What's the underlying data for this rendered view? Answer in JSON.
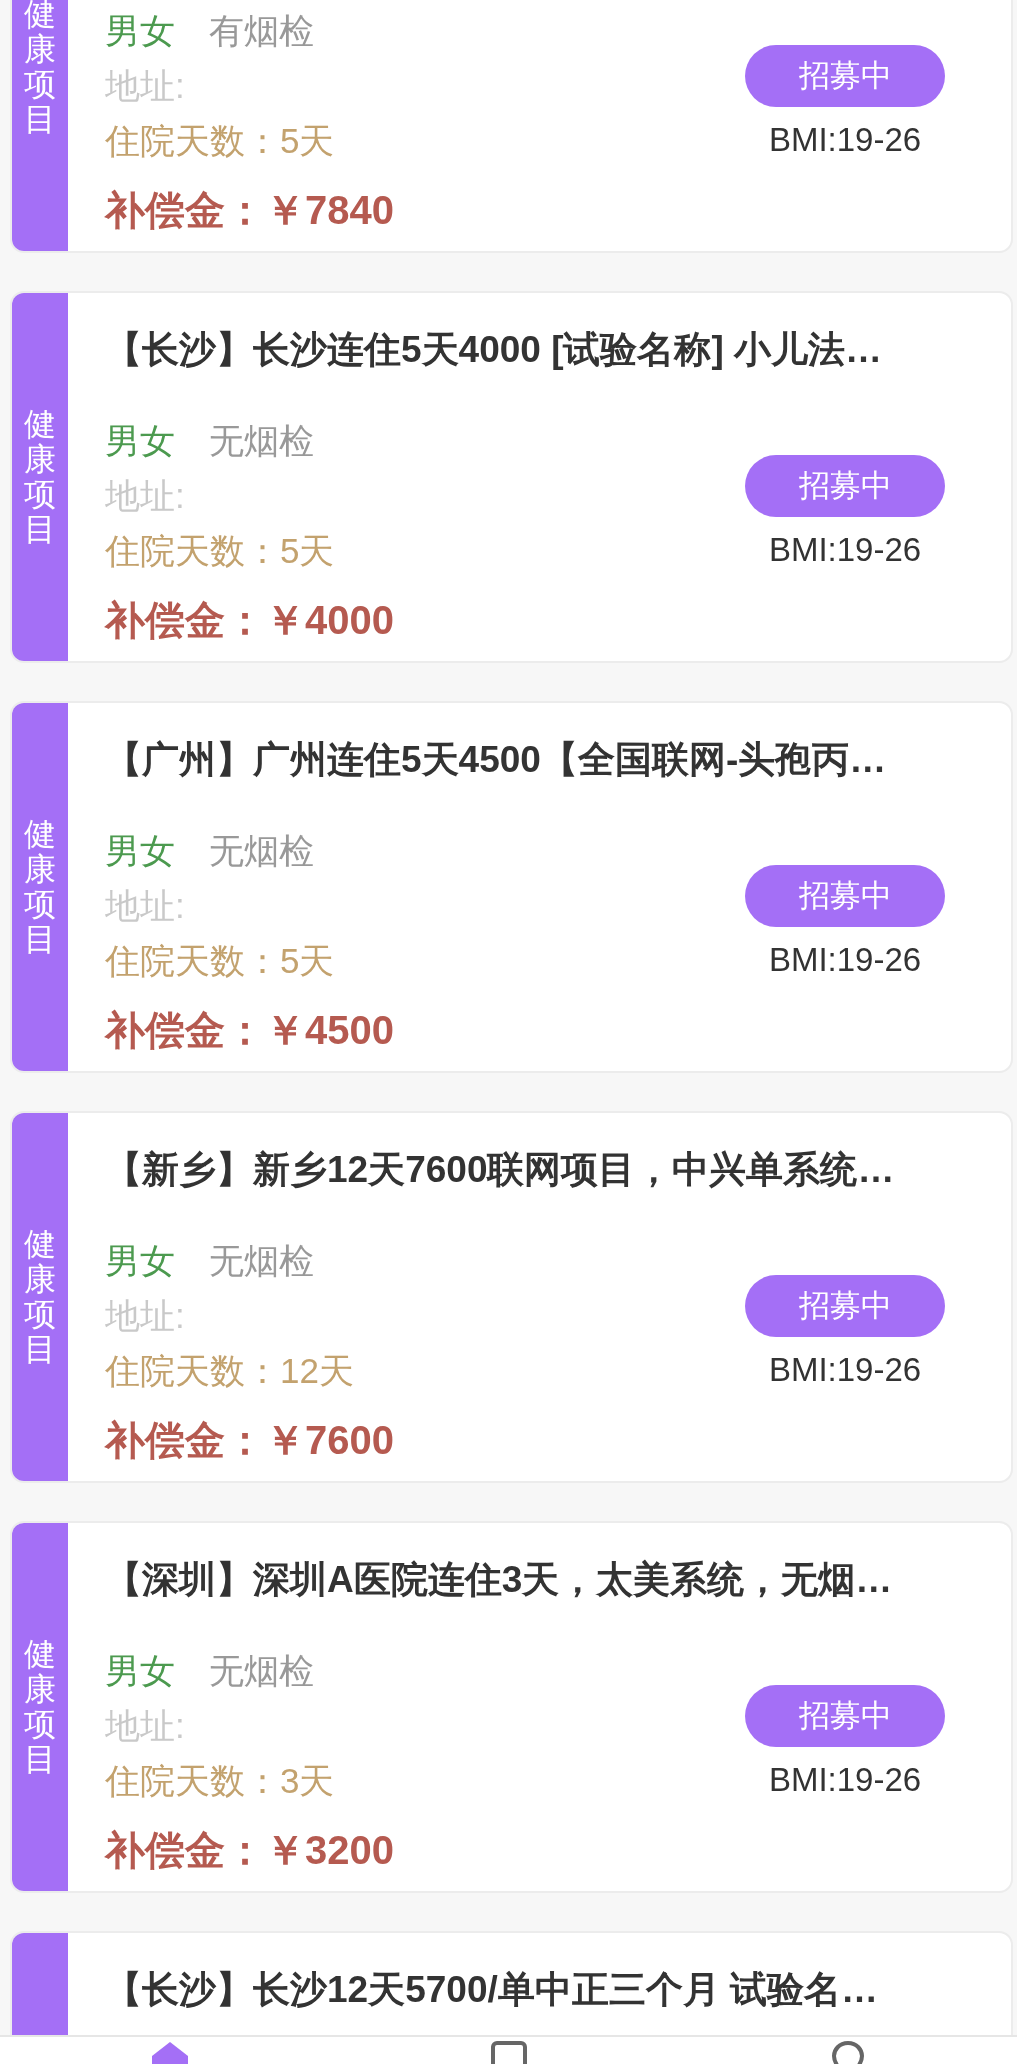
{
  "cards": [
    {
      "tag": "健康项目",
      "gender": "男女",
      "smoke_check": "有烟检",
      "address_label": "地址:",
      "days": "住院天数：5天",
      "compensation": "补偿金：￥7840",
      "status": "招募中",
      "bmi": "BMI:19-26"
    },
    {
      "tag": "健康项目",
      "title": "【长沙】长沙连住5天4000 [试验名称] 小儿法…",
      "gender": "男女",
      "smoke_check": "无烟检",
      "address_label": "地址:",
      "days": "住院天数：5天",
      "compensation": "补偿金：￥4000",
      "status": "招募中",
      "bmi": "BMI:19-26"
    },
    {
      "tag": "健康项目",
      "title": "【广州】广州连住5天4500【全国联网-头孢丙…",
      "gender": "男女",
      "smoke_check": "无烟检",
      "address_label": "地址:",
      "days": "住院天数：5天",
      "compensation": "补偿金：￥4500",
      "status": "招募中",
      "bmi": "BMI:19-26"
    },
    {
      "tag": "健康项目",
      "title": "【新乡】新乡12天7600联网项目，中兴单系统…",
      "gender": "男女",
      "smoke_check": "无烟检",
      "address_label": "地址:",
      "days": "住院天数：12天",
      "compensation": "补偿金：￥7600",
      "status": "招募中",
      "bmi": "BMI:19-26"
    },
    {
      "tag": "健康项目",
      "title": "【深圳】深圳A医院连住3天，太美系统，无烟…",
      "gender": "男女",
      "smoke_check": "无烟检",
      "address_label": "地址:",
      "days": "住院天数：3天",
      "compensation": "补偿金：￥3200",
      "status": "招募中",
      "bmi": "BMI:19-26"
    },
    {
      "title": "【长沙】长沙12天5700/单中正三个月 试验名…"
    }
  ],
  "bottom_nav": [
    {
      "kind": "home",
      "selected": true
    },
    {
      "kind": "list",
      "selected": false
    },
    {
      "kind": "location",
      "selected": false
    }
  ]
}
